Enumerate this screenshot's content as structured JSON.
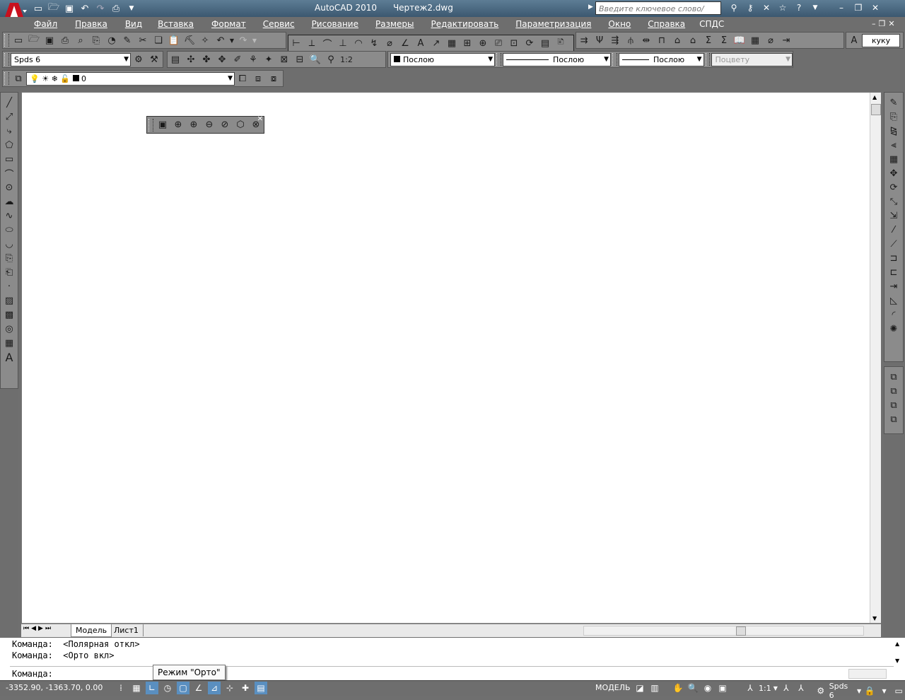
{
  "app": {
    "title": "AutoCAD 2010",
    "document": "Чертеж2.dwg",
    "search_placeholder": "Введите ключевое слово/фразу"
  },
  "menu": [
    "Файл",
    "Правка",
    "Вид",
    "Вставка",
    "Формат",
    "Сервис",
    "Рисование",
    "Размеры",
    "Редактировать",
    "Параметризация",
    "Окно",
    "Справка",
    "СПДС"
  ],
  "workspace_label": "куку",
  "toolbar2": {
    "style_name": "Spds 6",
    "scale_label": "1:2",
    "color": "Послою",
    "linetype": "Послою",
    "lineweight": "Послою",
    "plotstyle": "Поцвету"
  },
  "layer": {
    "current": "0"
  },
  "tabs": [
    "Модель",
    "Лист1"
  ],
  "command": {
    "lines": [
      "Команда:  <Полярная откл>",
      "Команда:  <Орто вкл>"
    ],
    "prompt": "Команда:"
  },
  "tooltip": "Режим \"Орто\"",
  "status": {
    "coords": "-3352.90, -1363.70, 0.00",
    "model_label": "МОДЕЛЬ",
    "annotation_scale": "1:1",
    "workspace": "Spds 6"
  },
  "colors": {
    "title_bar": "#4a6a82",
    "toolbar": "#8b8b8b",
    "chrome": "#6e6e6e",
    "canvas": "#ffffff"
  }
}
